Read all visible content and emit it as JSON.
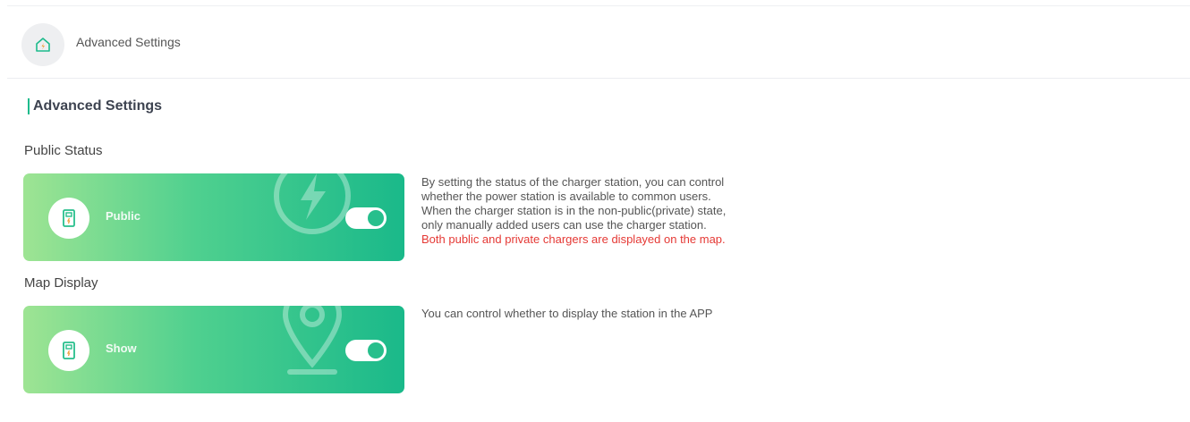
{
  "header": {
    "title": "Advanced Settings",
    "icon": "house-charger-icon"
  },
  "section": {
    "title": "Advanced Settings"
  },
  "public_status": {
    "label": "Public Status",
    "card_text": "Public",
    "toggle_on": true,
    "description_lines": [
      "By setting the status of the charger station, you can control",
      "whether the power station is available to common users.",
      "When the charger station is in the non-public(private) state,",
      "only manually added users can use the charger station."
    ],
    "warning": "Both public and private chargers are displayed on the map."
  },
  "map_display": {
    "label": "Map Display",
    "card_text": "Show",
    "toggle_on": true,
    "description": "You can control whether to display the station in the APP"
  },
  "colors": {
    "accent": "#1dbb8c",
    "warning": "#e53935",
    "card_gradient_start": "#9ee493",
    "card_gradient_end": "#1ab98a"
  }
}
